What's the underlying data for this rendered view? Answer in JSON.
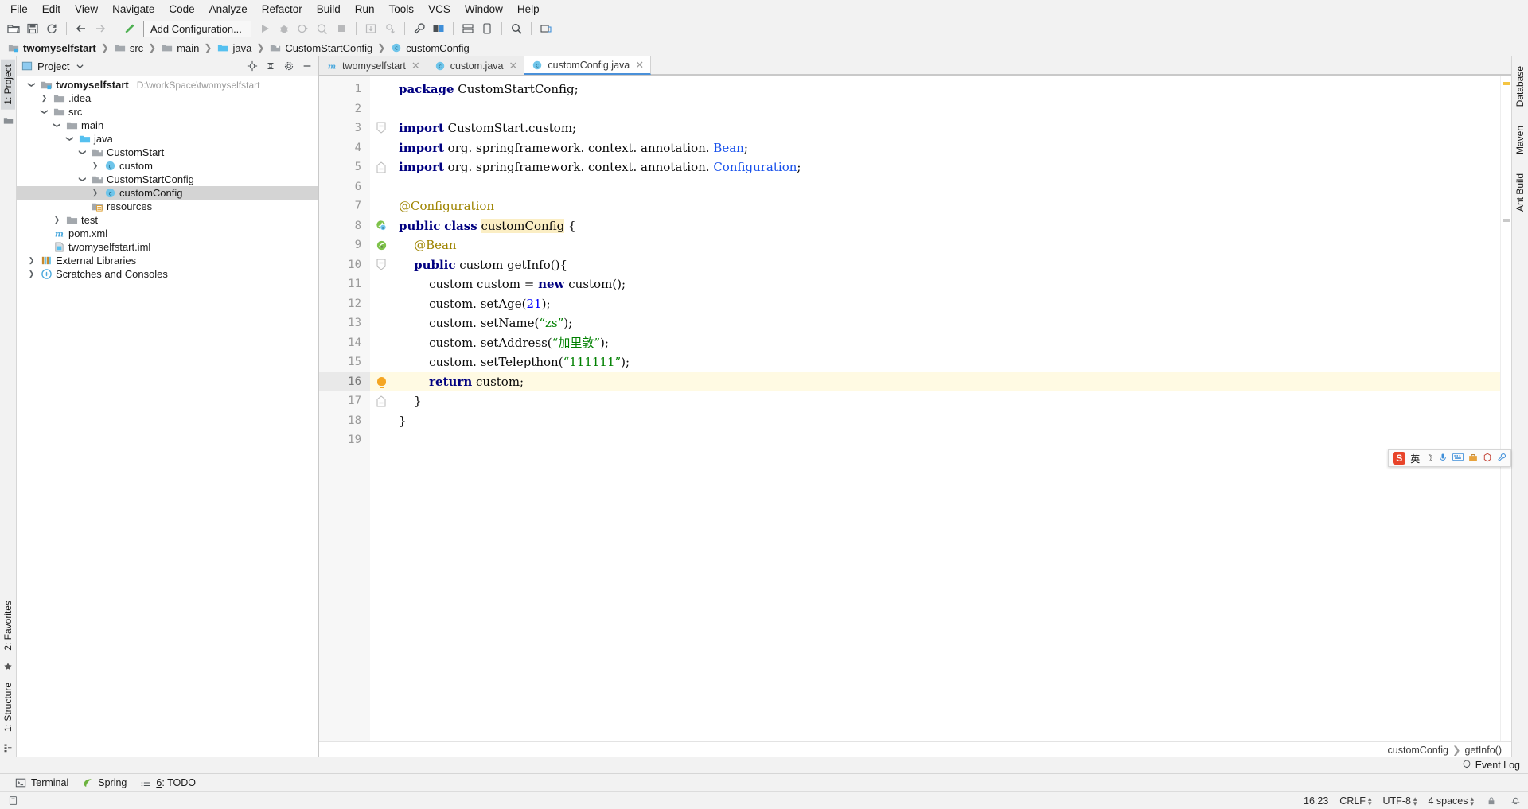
{
  "menu": {
    "items": [
      "File",
      "Edit",
      "View",
      "Navigate",
      "Code",
      "Analyze",
      "Refactor",
      "Build",
      "Run",
      "Tools",
      "VCS",
      "Window",
      "Help"
    ]
  },
  "toolbar": {
    "run_configuration": "Add Configuration...",
    "icons": [
      "open-folder-icon",
      "save-icon",
      "sync-icon",
      "back-arrow-icon",
      "forward-arrow-icon",
      "build-hammer-icon",
      "run-icon",
      "debug-icon",
      "run-coverage-icon",
      "profile-icon",
      "stop-icon",
      "update-icon",
      "commit-icon",
      "wrench-icon",
      "structure-icon",
      "search-icon",
      "maven-icon"
    ]
  },
  "breadcrumb": {
    "items": [
      {
        "label": "twomyselfstart",
        "icon": "module-icon",
        "bold": true
      },
      {
        "label": "src",
        "icon": "folder-icon",
        "bold": false
      },
      {
        "label": "main",
        "icon": "folder-icon",
        "bold": false
      },
      {
        "label": "java",
        "icon": "source-folder-icon",
        "bold": false
      },
      {
        "label": "CustomStartConfig",
        "icon": "package-icon",
        "bold": false
      },
      {
        "label": "customConfig",
        "icon": "class-icon",
        "bold": false
      }
    ]
  },
  "left_strip": {
    "project_tab": "1: Project",
    "favorites_tab": "2: Favorites",
    "structure_tab": "1: Structure"
  },
  "right_strip": {
    "tabs": [
      "Database",
      "Maven",
      "Ant Build"
    ]
  },
  "project_panel": {
    "title": "Project",
    "header_icons": [
      "locate-icon",
      "collapse-all-icon",
      "settings-gear-icon",
      "hide-icon"
    ],
    "tree": [
      {
        "depth": 0,
        "arrow": "down",
        "icon": "module-icon",
        "label": "twomyselfstart",
        "bold": true,
        "path": "D:\\workSpace\\twomyselfstart",
        "selected": false
      },
      {
        "depth": 1,
        "arrow": "right",
        "icon": "folder-icon",
        "label": ".idea",
        "bold": false,
        "path": "",
        "selected": false
      },
      {
        "depth": 1,
        "arrow": "down",
        "icon": "folder-icon",
        "label": "src",
        "bold": false,
        "path": "",
        "selected": false
      },
      {
        "depth": 2,
        "arrow": "down",
        "icon": "folder-icon",
        "label": "main",
        "bold": false,
        "path": "",
        "selected": false
      },
      {
        "depth": 3,
        "arrow": "down",
        "icon": "source-folder-icon",
        "label": "java",
        "bold": false,
        "path": "",
        "selected": false
      },
      {
        "depth": 4,
        "arrow": "down",
        "icon": "package-icon",
        "label": "CustomStart",
        "bold": false,
        "path": "",
        "selected": false
      },
      {
        "depth": 5,
        "arrow": "right",
        "icon": "class-icon",
        "label": "custom",
        "bold": false,
        "path": "",
        "selected": false
      },
      {
        "depth": 4,
        "arrow": "down",
        "icon": "package-icon",
        "label": "CustomStartConfig",
        "bold": false,
        "path": "",
        "selected": false
      },
      {
        "depth": 5,
        "arrow": "right",
        "icon": "class-icon",
        "label": "customConfig",
        "bold": false,
        "path": "",
        "selected": true
      },
      {
        "depth": 4,
        "arrow": "none",
        "icon": "resources-icon",
        "label": "resources",
        "bold": false,
        "path": "",
        "selected": false
      },
      {
        "depth": 2,
        "arrow": "right",
        "icon": "folder-icon",
        "label": "test",
        "bold": false,
        "path": "",
        "selected": false
      },
      {
        "depth": 1,
        "arrow": "none",
        "icon": "maven-file-icon",
        "label": "pom.xml",
        "bold": false,
        "path": "",
        "selected": false
      },
      {
        "depth": 1,
        "arrow": "none",
        "icon": "iml-file-icon",
        "label": "twomyselfstart.iml",
        "bold": false,
        "path": "",
        "selected": false
      },
      {
        "depth": 0,
        "arrow": "right",
        "icon": "library-icon",
        "label": "External Libraries",
        "bold": false,
        "path": "",
        "selected": false
      },
      {
        "depth": 0,
        "arrow": "right",
        "icon": "scratches-icon",
        "label": "Scratches and Consoles",
        "bold": false,
        "path": "",
        "selected": false
      }
    ]
  },
  "editor_tabs": [
    {
      "label": "twomyselfstart",
      "icon": "maven-file-icon",
      "active": false
    },
    {
      "label": "custom.java",
      "icon": "class-icon",
      "active": false
    },
    {
      "label": "customConfig.java",
      "icon": "class-icon",
      "active": true
    }
  ],
  "editor": {
    "language": "java",
    "current_line": 16,
    "lines": [
      {
        "n": 1,
        "fold": "",
        "gutter": "",
        "text": "package CustomStartConfig;"
      },
      {
        "n": 2,
        "fold": "",
        "gutter": "",
        "text": ""
      },
      {
        "n": 3,
        "fold": "start",
        "gutter": "",
        "text": "import CustomStart.custom;"
      },
      {
        "n": 4,
        "fold": "",
        "gutter": "",
        "text": "import org. springframework. context. annotation. Bean;"
      },
      {
        "n": 5,
        "fold": "end",
        "gutter": "",
        "text": "import org. springframework. context. annotation. Configuration;"
      },
      {
        "n": 6,
        "fold": "",
        "gutter": "",
        "text": ""
      },
      {
        "n": 7,
        "fold": "",
        "gutter": "",
        "text": "@Configuration"
      },
      {
        "n": 8,
        "fold": "",
        "gutter": "spring-bean-class-icon",
        "text": "public class customConfig {"
      },
      {
        "n": 9,
        "fold": "",
        "gutter": "spring-bean-icon",
        "text": "    @Bean"
      },
      {
        "n": 10,
        "fold": "start",
        "gutter": "",
        "text": "    public custom getInfo(){"
      },
      {
        "n": 11,
        "fold": "",
        "gutter": "",
        "text": "        custom custom = new custom();"
      },
      {
        "n": 12,
        "fold": "",
        "gutter": "",
        "text": "        custom. setAge(21);"
      },
      {
        "n": 13,
        "fold": "",
        "gutter": "",
        "text": "        custom. setName(\"zs\");"
      },
      {
        "n": 14,
        "fold": "",
        "gutter": "",
        "text": "        custom. setAddress(\"加里敦\");"
      },
      {
        "n": 15,
        "fold": "",
        "gutter": "",
        "text": "        custom. setTelepthon(\"111111\");"
      },
      {
        "n": 16,
        "fold": "",
        "gutter": "intention-bulb-icon",
        "text": "        return custom;"
      },
      {
        "n": 17,
        "fold": "end",
        "gutter": "",
        "text": "    }"
      },
      {
        "n": 18,
        "fold": "",
        "gutter": "",
        "text": "}"
      },
      {
        "n": 19,
        "fold": "",
        "gutter": "",
        "text": ""
      }
    ],
    "breadcrumbs": [
      "customConfig",
      "getInfo()"
    ]
  },
  "ime_bar": {
    "logo": "S",
    "mode_label": "英",
    "icons": [
      "moon-icon",
      "voice-icon",
      "keyboard-icon",
      "toolbox-icon",
      "skin-icon",
      "settings-wrench-icon"
    ]
  },
  "bottom_bar": {
    "items": [
      {
        "label": "Terminal",
        "icon": "terminal-icon",
        "mnemonic": ""
      },
      {
        "label": "Spring",
        "icon": "spring-leaf-icon",
        "mnemonic": ""
      },
      {
        "label": "TODO",
        "icon": "todo-list-icon",
        "mnemonic": "6"
      }
    ]
  },
  "event_log": {
    "label": "Event Log",
    "icon": "balloon-icon"
  },
  "status_bar": {
    "caret_position": "16:23",
    "line_separator": "CRLF",
    "encoding": "UTF-8",
    "indent": "4 spaces",
    "lock_icon": "lock-icon",
    "inspection_icon": "inspector-hat-icon"
  },
  "colors": {
    "accent": "#4a90d9",
    "keyword": "#000080",
    "string": "#008000",
    "annotation": "#9e8400",
    "number": "#0000ff",
    "selection": "#d4d4d4",
    "current_line": "#fffae3"
  }
}
